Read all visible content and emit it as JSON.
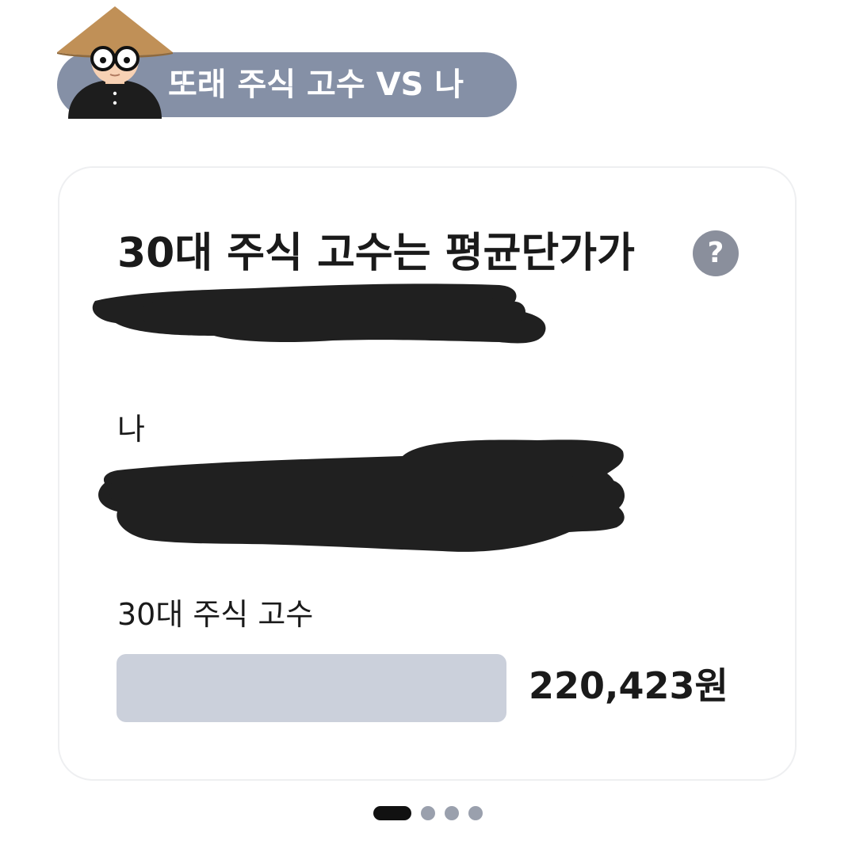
{
  "header": {
    "title": "또래 주식 고수 VS 나",
    "avatar_icon": "avatar-with-straw-hat-icon",
    "pill_color": "#8590a6"
  },
  "card": {
    "title": "30대 주식 고수는 평균단가가",
    "help_label": "?",
    "help_icon": "question-circle-icon",
    "me": {
      "label": "나"
    },
    "expert": {
      "label": "30대 주식 고수",
      "value": "220,423원",
      "bar_color": "#cbd0db"
    }
  },
  "pagination": {
    "total": 4,
    "active_index": 0
  }
}
